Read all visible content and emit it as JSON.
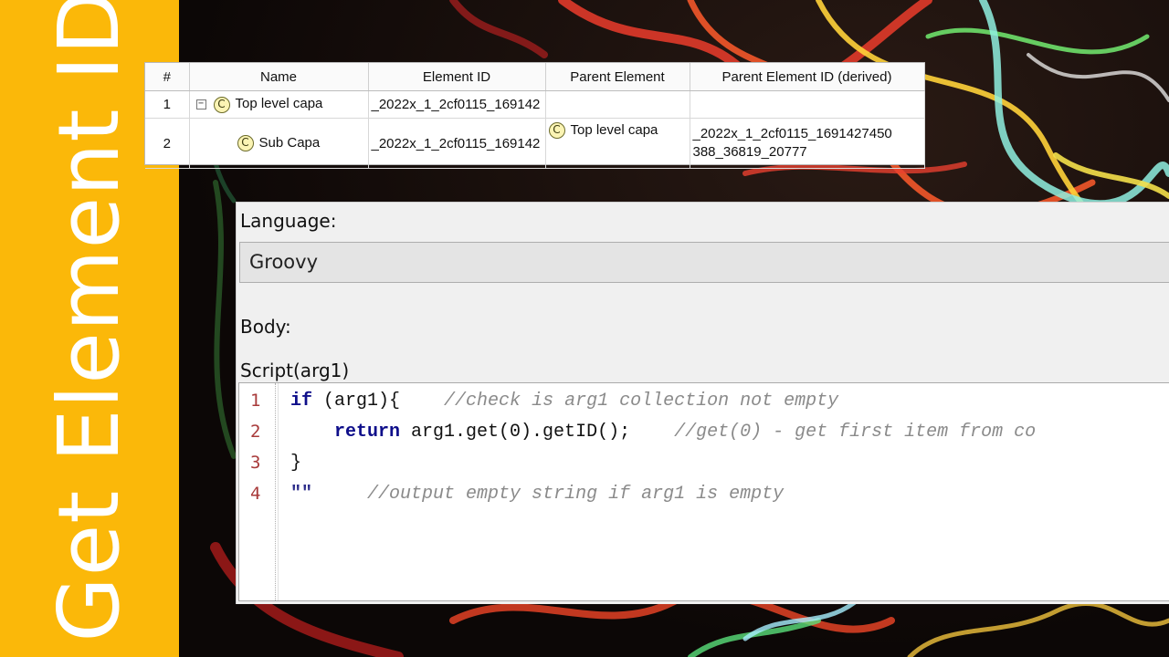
{
  "banner": {
    "title": "Get Element ID",
    "color": "#fbb809"
  },
  "table": {
    "headers": [
      "#",
      "Name",
      "Element ID",
      "Parent Element",
      "Parent Element ID (derived)"
    ],
    "rows": [
      {
        "num": "1",
        "name": "Top level capa",
        "element_id": "_2022x_1_2cf0115_169142",
        "parent_element": "",
        "parent_element_id": ""
      },
      {
        "num": "2",
        "name": "Sub Capa",
        "element_id": "_2022x_1_2cf0115_169142",
        "parent_element": "Top level capa",
        "parent_element_id": "_2022x_1_2cf0115_1691427450 388_36819_20777"
      }
    ],
    "icons": {
      "class_icon_glyph": "C",
      "class_icon": "class-c-icon",
      "collapse_icon": "collapse-minus-icon",
      "collapse_glyph": "−"
    }
  },
  "editor": {
    "language_label": "Language:",
    "language_value": "Groovy",
    "body_label": "Body:",
    "script_label": "Script(arg1)",
    "lines": [
      {
        "num": "1",
        "kw": "if",
        "code": " (arg1){",
        "pad": "    ",
        "comment": "//check is arg1 collection not empty"
      },
      {
        "num": "2",
        "indent": "    ",
        "kw": "return",
        "code": " arg1.get(0).getID();",
        "pad": "    ",
        "comment": "//get(0) - get first item from co"
      },
      {
        "num": "3",
        "code": "}"
      },
      {
        "num": "4",
        "str": "\"\"",
        "pad": "     ",
        "comment": "//output empty string if arg1 is empty"
      }
    ]
  }
}
